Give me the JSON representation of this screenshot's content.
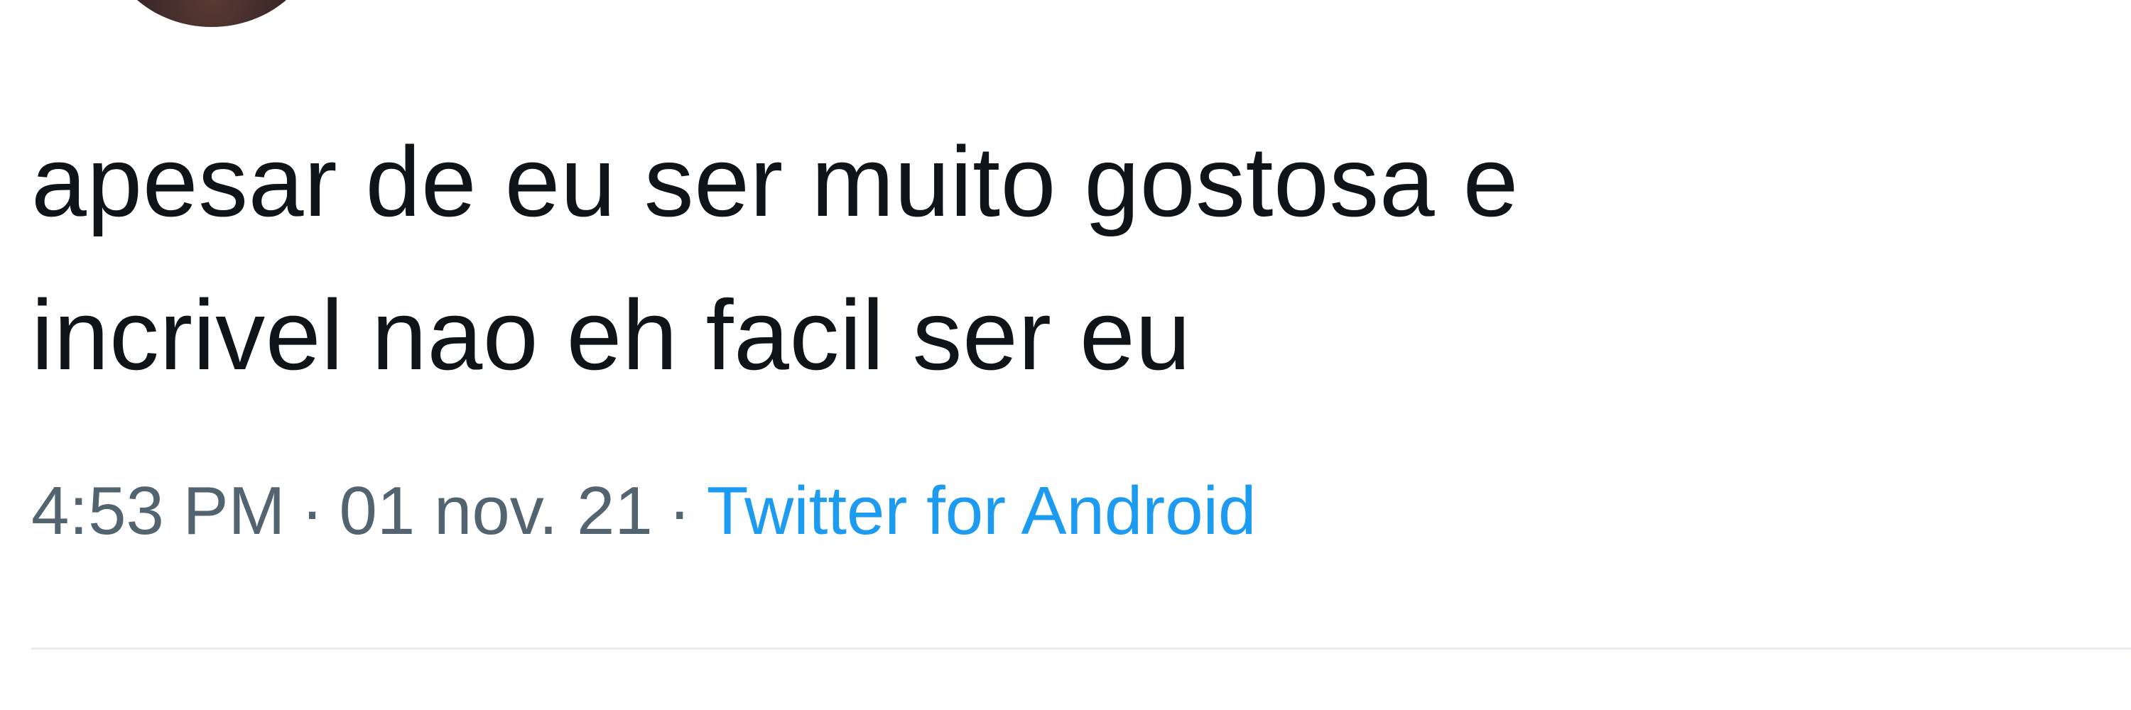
{
  "tweet": {
    "text_lines": [
      "apesar de eu ser muito gostosa e",
      "incrivel nao eh facil ser eu"
    ],
    "time": "4:53 PM",
    "separator": "·",
    "date": "01 nov. 21",
    "source": "Twitter for Android"
  },
  "colors": {
    "text": "#0f1419",
    "meta": "#536471",
    "link": "#1d9bf0",
    "divider": "#e6ecf0"
  }
}
